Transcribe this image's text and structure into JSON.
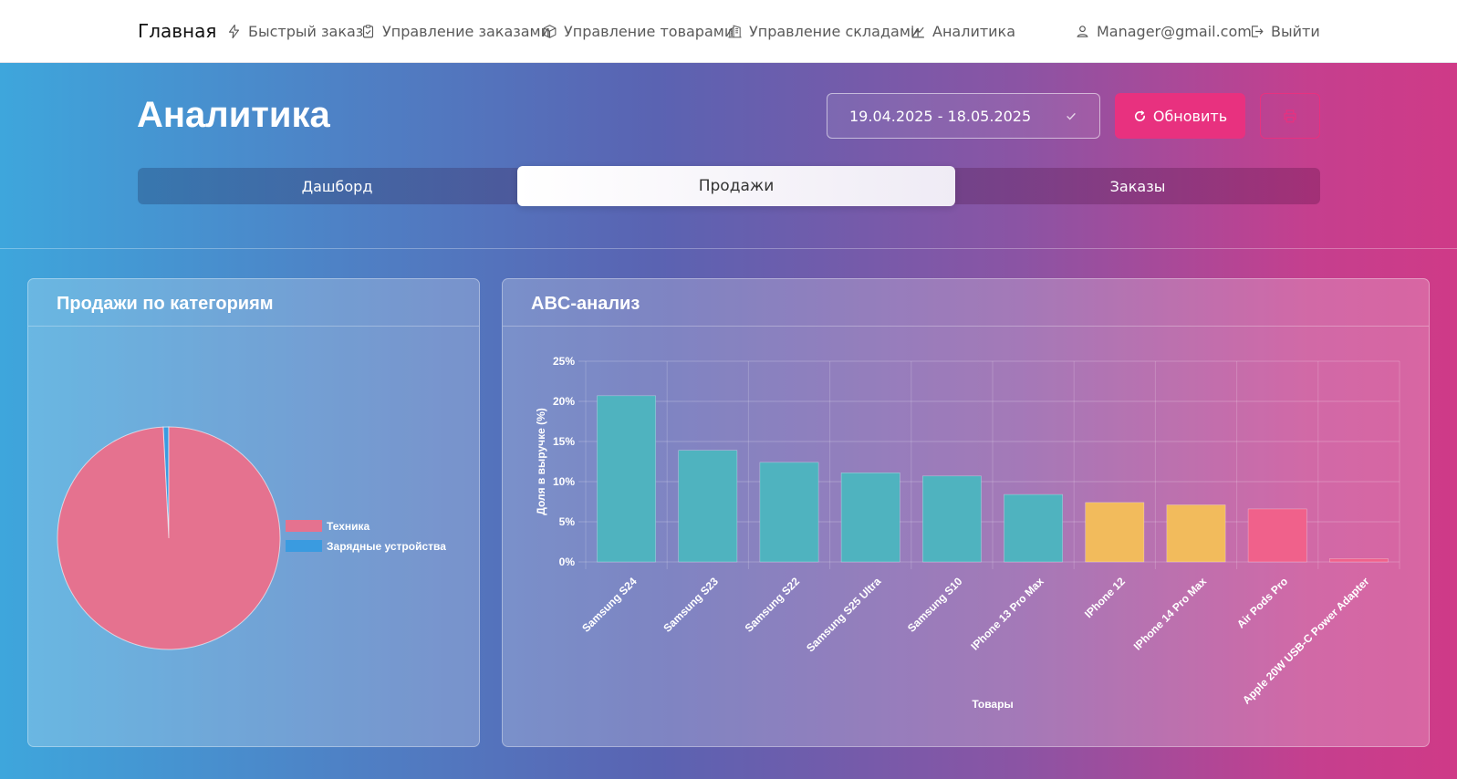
{
  "nav": {
    "brand": "Главная",
    "items": [
      {
        "label": "Быстрый заказ",
        "icon": "lightning-icon"
      },
      {
        "label": "Управление заказами",
        "icon": "clipboard-check-icon"
      },
      {
        "label": "Управление товарами",
        "icon": "box-icon"
      },
      {
        "label": "Управление складами",
        "icon": "building-icon"
      },
      {
        "label": "Аналитика",
        "icon": "chart-line-icon"
      }
    ],
    "user": "Manager@gmail.com",
    "logout": "Выйти"
  },
  "header": {
    "title": "Аналитика",
    "date_range": "19.04.2025 - 18.05.2025",
    "refresh_label": "Обновить"
  },
  "tabs": [
    {
      "label": "Дашборд",
      "active": false
    },
    {
      "label": "Продажи",
      "active": true
    },
    {
      "label": "Заказы",
      "active": false
    }
  ],
  "colors": {
    "accent": "#e8317f",
    "class_a": "#4fb3bf",
    "class_b": "#f2bb5c",
    "class_c": "#f0618b",
    "pie_tech": "#e5728f",
    "pie_chargers": "#3a9be0"
  },
  "cards": {
    "pie_title": "Продажи по категориям",
    "abc_title": "ABC-анализ"
  },
  "chart_data": [
    {
      "type": "pie",
      "title": "Продажи по категориям",
      "legend_position": "right",
      "slices": [
        {
          "label": "Техника",
          "value": 99.2,
          "color": "#e5728f"
        },
        {
          "label": "Зарядные устройства",
          "value": 0.8,
          "color": "#3a9be0"
        }
      ]
    },
    {
      "type": "bar",
      "title": "ABC-анализ",
      "xlabel": "Товары",
      "ylabel": "Доля в выручке (%)",
      "ylim": [
        0,
        25
      ],
      "yticks": [
        "0%",
        "5%",
        "10%",
        "15%",
        "20%",
        "25%"
      ],
      "grid": true,
      "categories": [
        "Samsung S24",
        "Samsung S23",
        "Samsung S22",
        "Samsung S25 Ultra",
        "Samsung S10",
        "IPhone 13 Pro Max",
        "IPhone 12",
        "IPhone 14 Pro Max",
        "Air Pods Pro",
        "Apple 20W USB-C Power Adapter"
      ],
      "values": [
        20.7,
        13.9,
        12.4,
        11.1,
        10.7,
        8.4,
        7.4,
        7.1,
        6.6,
        0.4
      ],
      "bar_colors": [
        "#4fb3bf",
        "#4fb3bf",
        "#4fb3bf",
        "#4fb3bf",
        "#4fb3bf",
        "#4fb3bf",
        "#f2bb5c",
        "#f2bb5c",
        "#f0618b",
        "#f0618b"
      ]
    }
  ]
}
